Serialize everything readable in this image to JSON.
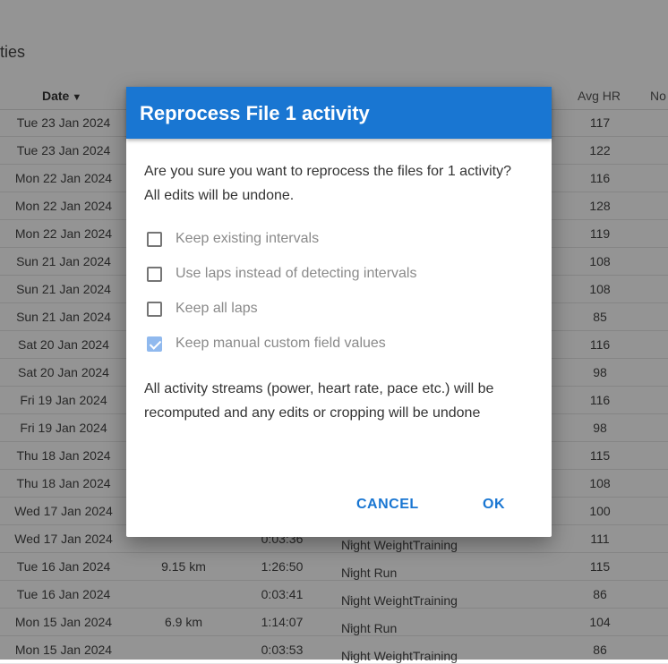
{
  "page": {
    "title_partial": "ities"
  },
  "table": {
    "headers": {
      "date": "Date",
      "sort_arrow": "▼",
      "avg_hr": "Avg HR",
      "more": "No"
    },
    "rows": [
      {
        "date": "Tue 23 Jan 2024",
        "distance": "",
        "time": "",
        "name": "",
        "hr": "117"
      },
      {
        "date": "Tue 23 Jan 2024",
        "distance": "",
        "time": "",
        "name": "",
        "hr": "122"
      },
      {
        "date": "Mon 22 Jan 2024",
        "distance": "",
        "time": "",
        "name": "",
        "hr": "116"
      },
      {
        "date": "Mon 22 Jan 2024",
        "distance": "",
        "time": "",
        "name": "",
        "hr": "128"
      },
      {
        "date": "Mon 22 Jan 2024",
        "distance": "",
        "time": "",
        "name": "",
        "hr": "119"
      },
      {
        "date": "Sun 21 Jan 2024",
        "distance": "",
        "time": "",
        "name": "",
        "hr": "108"
      },
      {
        "date": "Sun 21 Jan 2024",
        "distance": "",
        "time": "",
        "name": "",
        "hr": "108"
      },
      {
        "date": "Sun 21 Jan 2024",
        "distance": "",
        "time": "",
        "name": "",
        "hr": "85"
      },
      {
        "date": "Sat 20 Jan 2024",
        "distance": "",
        "time": "",
        "name": "",
        "hr": "116"
      },
      {
        "date": "Sat 20 Jan 2024",
        "distance": "",
        "time": "",
        "name": "",
        "hr": "98"
      },
      {
        "date": "Fri 19 Jan 2024",
        "distance": "",
        "time": "",
        "name": "",
        "hr": "116"
      },
      {
        "date": "Fri 19 Jan 2024",
        "distance": "",
        "time": "",
        "name": "",
        "hr": "98"
      },
      {
        "date": "Thu 18 Jan 2024",
        "distance": "",
        "time": "",
        "name": "",
        "hr": "115"
      },
      {
        "date": "Thu 18 Jan 2024",
        "distance": "",
        "time": "",
        "name": "",
        "hr": "108"
      },
      {
        "date": "Wed 17 Jan 2024",
        "distance": "",
        "time": "",
        "name": "",
        "hr": "100"
      },
      {
        "date": "Wed 17 Jan 2024",
        "distance": "",
        "time": "0:03:36",
        "name": "Night WeightTraining",
        "hr": "111"
      },
      {
        "date": "Tue 16 Jan 2024",
        "distance": "9.15 km",
        "time": "1:26:50",
        "name": "Night Run",
        "hr": "115"
      },
      {
        "date": "Tue 16 Jan 2024",
        "distance": "",
        "time": "0:03:41",
        "name": "Night WeightTraining",
        "hr": "86"
      },
      {
        "date": "Mon 15 Jan 2024",
        "distance": "6.9 km",
        "time": "1:14:07",
        "name": "Night Run",
        "hr": "104"
      },
      {
        "date": "Mon 15 Jan 2024",
        "distance": "",
        "time": "0:03:53",
        "name": "Night WeightTraining",
        "hr": "86"
      }
    ]
  },
  "dialog": {
    "title": "Reprocess File 1 activity",
    "message": "Are you sure you want to reprocess the files for 1 activity? All edits will be undone.",
    "options": [
      {
        "label": "Keep existing intervals",
        "checked": false
      },
      {
        "label": "Use laps instead of detecting intervals",
        "checked": false
      },
      {
        "label": "Keep all laps",
        "checked": false
      },
      {
        "label": "Keep manual custom field values",
        "checked": true
      }
    ],
    "note": "All activity streams (power, heart rate, pace etc.) will be recomputed and any edits or cropping will be undone",
    "cancel_label": "CANCEL",
    "ok_label": "OK"
  },
  "colors": {
    "accent": "#1976d2",
    "checkbox_checked": "#90b9ee"
  }
}
